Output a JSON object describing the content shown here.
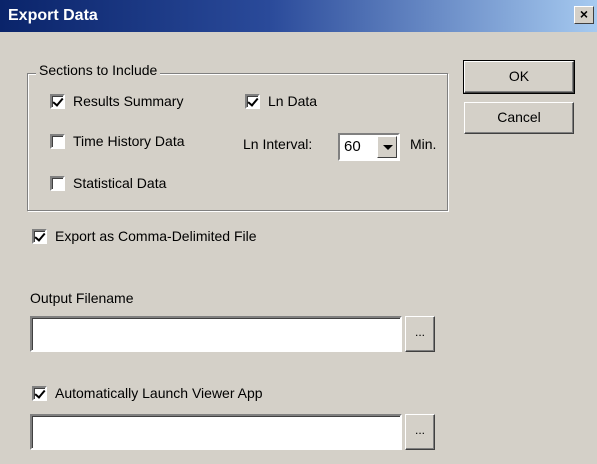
{
  "window": {
    "title": "Export Data",
    "close_glyph": "×"
  },
  "sections": {
    "label": "Sections to Include",
    "results_summary": {
      "label": "Results Summary",
      "checked": true
    },
    "time_history": {
      "label": "Time History Data",
      "checked": false
    },
    "statistical": {
      "label": "Statistical Data",
      "checked": false
    },
    "ln_data": {
      "label": "Ln Data",
      "checked": true
    },
    "ln_interval": {
      "label": "Ln Interval:",
      "value": "60",
      "unit": "Min."
    }
  },
  "export_csv": {
    "label": "Export as Comma-Delimited File",
    "checked": true
  },
  "output": {
    "label": "Output Filename",
    "value": "",
    "browse_label": "..."
  },
  "launch_viewer": {
    "label": "Automatically Launch Viewer App",
    "checked": true,
    "value": "",
    "browse_label": "..."
  },
  "buttons": {
    "ok": "OK",
    "cancel": "Cancel"
  }
}
